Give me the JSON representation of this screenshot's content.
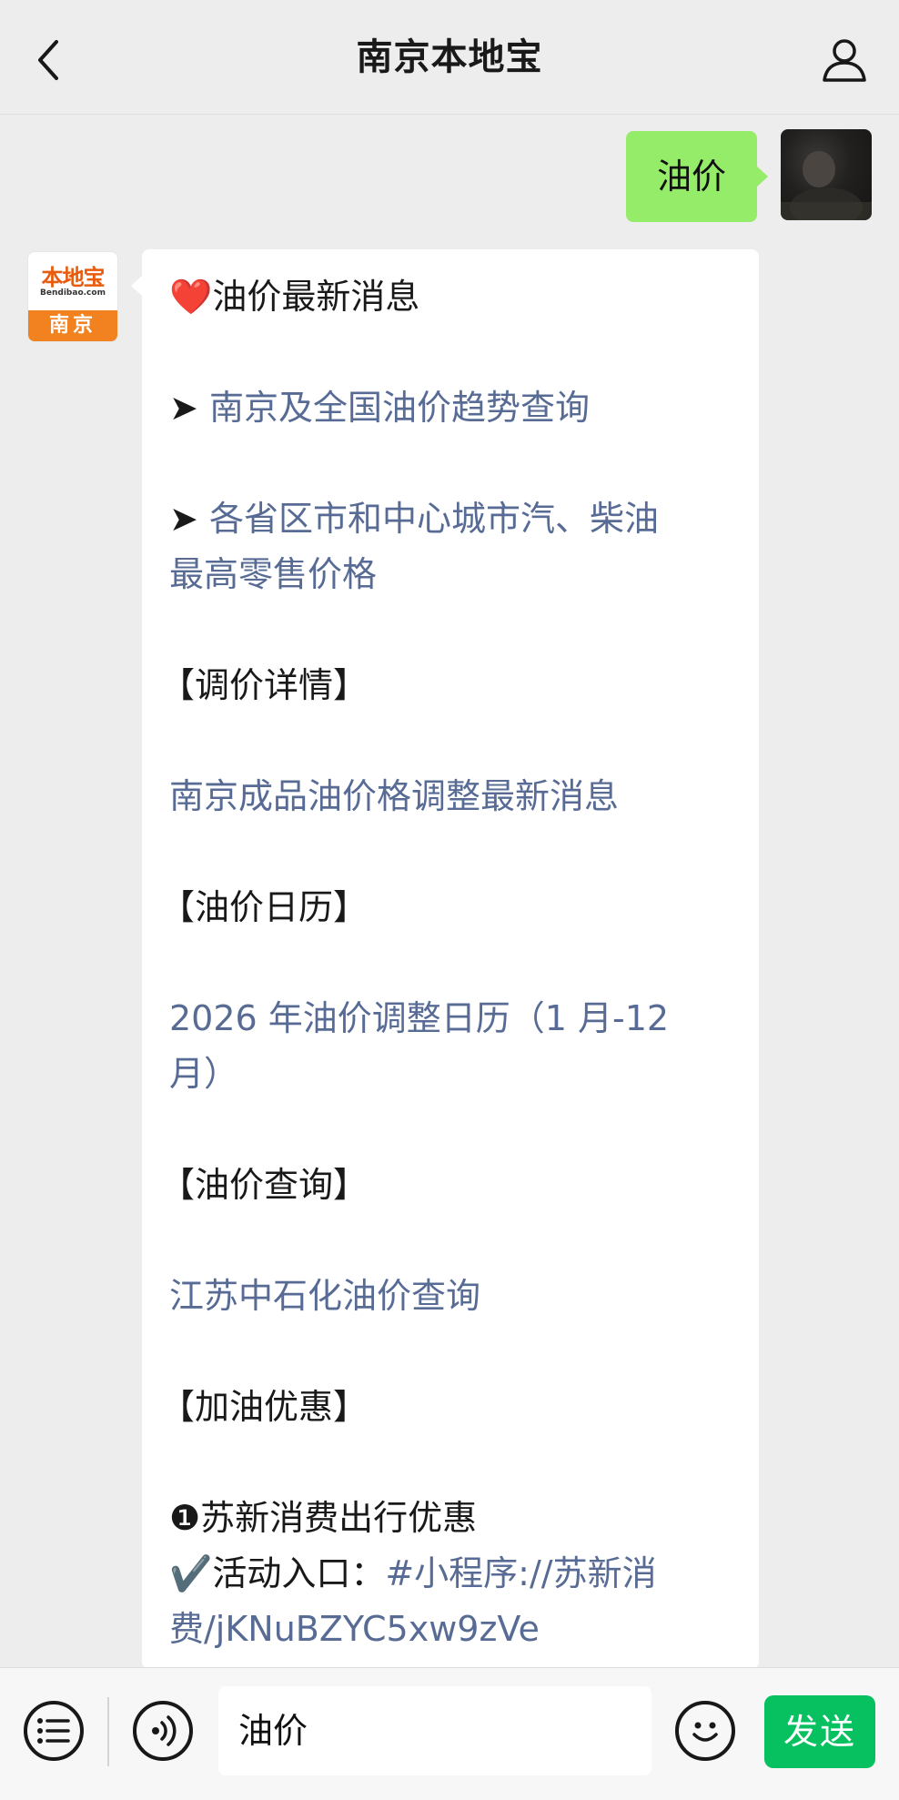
{
  "header": {
    "title": "南京本地宝",
    "back_icon": "chevron-left-icon",
    "profile_icon": "person-icon"
  },
  "chat": {
    "sent_message": "油价",
    "bot_logo": {
      "brand": "本地宝",
      "domain": "Bendibao.com",
      "city": "南京"
    },
    "reply": {
      "heading_icon": "❤️",
      "heading": "油价最新消息",
      "arrow": "➤",
      "link_trend": "南京及全国油价趋势查询",
      "link_retail_1": "各省区市和中心城市汽、柴油",
      "link_retail_2": "最高零售价格",
      "section_adjust": "【调价详情】",
      "link_adjust": "南京成品油价格调整最新消息",
      "section_calendar": "【油价日历】",
      "link_calendar_1": "2026 年油价调整日历（1 月-12",
      "link_calendar_2": "月）",
      "section_query": "【油价查询】",
      "link_query": "江苏中石化油价查询",
      "section_discount": "【加油优惠】",
      "item_number": "❶",
      "item_title": "苏新消费出行优惠",
      "check_icon": "✔️",
      "entry_label": "活动入口：",
      "entry_link_1": "#小程序://苏新消",
      "entry_link_2": "费/jKNuBZYC5xw9zVe"
    }
  },
  "input_bar": {
    "value": "油价",
    "send_label": "发送"
  },
  "colors": {
    "background": "#ededed",
    "sent_bubble": "#95ec69",
    "link": "#576b95",
    "send_button": "#07c160",
    "logo_orange": "#f1821f"
  }
}
